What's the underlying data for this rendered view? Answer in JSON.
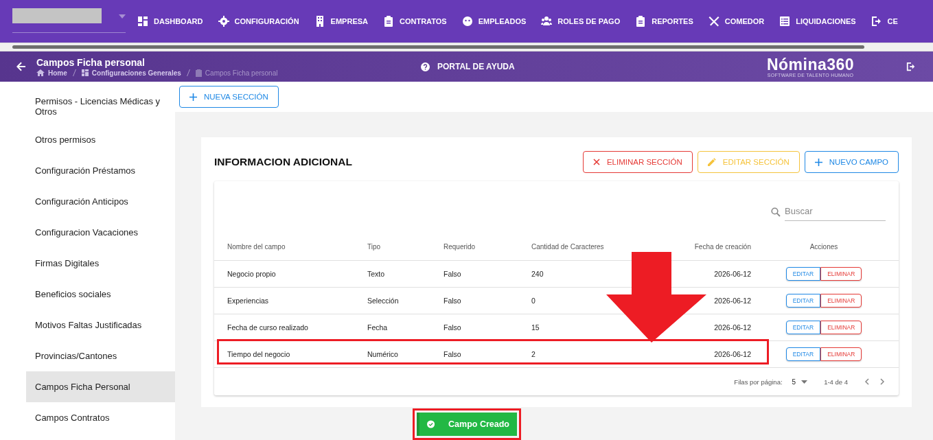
{
  "nav": {
    "items": [
      {
        "label": "DASHBOARD"
      },
      {
        "label": "CONFIGURACIÓN"
      },
      {
        "label": "EMPRESA"
      },
      {
        "label": "CONTRATOS"
      },
      {
        "label": "EMPLEADOS"
      },
      {
        "label": "ROLES DE PAGO"
      },
      {
        "label": "REPORTES"
      },
      {
        "label": "COMEDOR"
      },
      {
        "label": "LIQUIDACIONES"
      },
      {
        "label": "CE"
      }
    ]
  },
  "page_header": {
    "title": "Campos Ficha personal",
    "breadcrumbs": [
      {
        "label": "Home"
      },
      {
        "label": "Configuraciones Generales"
      },
      {
        "label": "Campos Ficha personal"
      }
    ],
    "help_link": "PORTAL DE AYUDA",
    "logo": {
      "name": "Nómina360",
      "tagline": "SOFTWARE DE TALENTO HUMANO"
    }
  },
  "sidebar": {
    "items": [
      {
        "label": "Permisos - Licencias Médicas y Otros",
        "selected": false
      },
      {
        "label": "Otros permisos",
        "selected": false
      },
      {
        "label": "Configuración Préstamos",
        "selected": false
      },
      {
        "label": "Configuración Anticipos",
        "selected": false
      },
      {
        "label": "Configuracion Vacaciones",
        "selected": false
      },
      {
        "label": "Firmas Digitales",
        "selected": false
      },
      {
        "label": "Beneficios sociales",
        "selected": false
      },
      {
        "label": "Motivos Faltas Justificadas",
        "selected": false
      },
      {
        "label": "Provincias/Cantones",
        "selected": false
      },
      {
        "label": "Campos Ficha Personal",
        "selected": true
      },
      {
        "label": "Campos Contratos",
        "selected": false
      }
    ]
  },
  "new_section_button": "NUEVA SECCIÓN",
  "section": {
    "title": "INFORMACION ADICIONAL",
    "buttons": [
      {
        "label": "ELIMINAR SECCIÓN",
        "kind": "delete"
      },
      {
        "label": "EDITAR SECCIÓN",
        "kind": "edit"
      },
      {
        "label": "NUEVO CAMPO",
        "kind": "add"
      }
    ],
    "search": {
      "placeholder": "Buscar"
    },
    "table": {
      "columns": [
        "Nombre del campo",
        "Tipo",
        "Requerido",
        "Cantidad de Caracteres",
        "Fecha de creación",
        "Acciones"
      ],
      "rows": [
        {
          "cells": [
            "Negocio propio",
            "Texto",
            "Falso",
            "240",
            "2026-06-12"
          ],
          "actions": [
            "EDITAR",
            "ELIMINAR"
          ],
          "highlighted": false
        },
        {
          "cells": [
            "Experiencias",
            "Selección",
            "Falso",
            "0",
            "2026-06-12"
          ],
          "actions": [
            "EDITAR",
            "ELIMINAR"
          ],
          "highlighted": false
        },
        {
          "cells": [
            "Fecha de curso realizado",
            "Fecha",
            "Falso",
            "15",
            "2026-06-12"
          ],
          "actions": [
            "EDITAR",
            "ELIMINAR"
          ],
          "highlighted": false
        },
        {
          "cells": [
            "Tiempo del negocio",
            "Numérico",
            "Falso",
            "2",
            "2026-06-12"
          ],
          "actions": [
            "EDITAR",
            "ELIMINAR"
          ],
          "highlighted": true
        }
      ]
    },
    "pagination": {
      "rows_per_page_label": "Filas por página:",
      "rows_per_page": "5",
      "range": "1-4 de 4"
    }
  },
  "toast": {
    "message": "Campo Creado",
    "highlighted": true
  }
}
